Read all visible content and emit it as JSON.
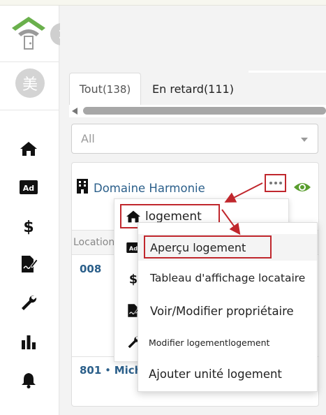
{
  "sidebar": {
    "avatar_char": "美",
    "nav_icons": [
      "home-icon",
      "ad-icon",
      "dollar-icon",
      "contract-icon",
      "wrench-icon",
      "bar-chart-icon",
      "bell-icon"
    ]
  },
  "tabs": [
    {
      "label": "Tout",
      "count": "(138)"
    },
    {
      "label": "En retard",
      "count": "(111)"
    }
  ],
  "filter": {
    "selected": "All"
  },
  "card": {
    "building_name": "Domaine Harmonie",
    "column_header": "Location U",
    "row1_unit": "008",
    "row2_unit": "801",
    "row2_sep": " • ",
    "row2_name": "Mich"
  },
  "menu": {
    "logement_label": "logement",
    "submenu": [
      "Aperçu logement",
      "Tableau d'affichage locataire",
      "Voir/Modifier propriétaire",
      "Modifier logementlogement",
      "Ajouter unité logement"
    ]
  },
  "colors": {
    "accent_red": "#c0272d",
    "link_blue": "#2b5f8a",
    "logo_green": "#6ab04c",
    "eye_green": "#5a9e2f"
  }
}
